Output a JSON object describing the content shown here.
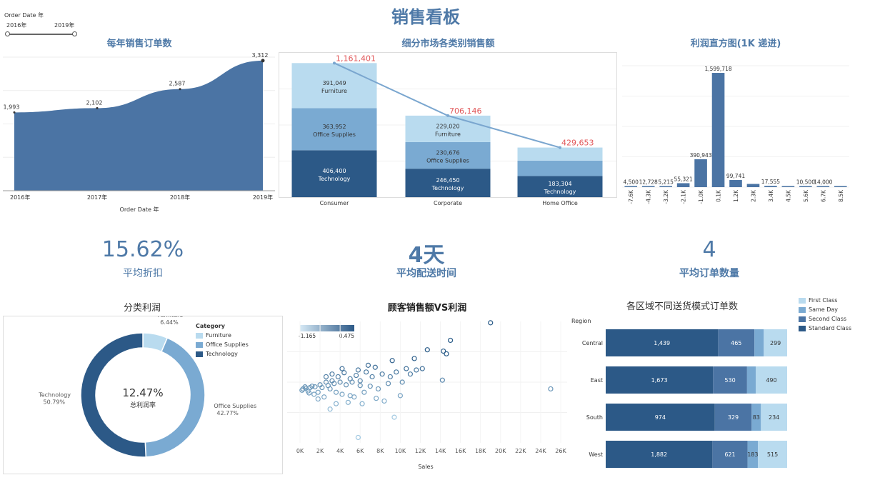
{
  "dashboard": {
    "title": "销售看板",
    "filter": {
      "field_label": "Order Date 年",
      "start_label": "2016年",
      "end_label": "2019年"
    }
  },
  "kpis": [
    {
      "value": "15.62%",
      "label": "平均折扣"
    },
    {
      "value": "4天",
      "label": "平均配送时间"
    },
    {
      "value": "4",
      "label": "平均订单数量"
    }
  ],
  "colors": {
    "brand": "#4e79a7",
    "furniture": "#b9dbef",
    "office_supplies": "#7aaad2",
    "technology": "#2c5987",
    "area_fill": "#4b74a4",
    "line_total": "#7aa6cf",
    "total_label": "#e15759"
  },
  "chart_data": [
    {
      "id": "orders_per_year",
      "type": "area",
      "title": "每年销售订单数",
      "xlabel": "Order Date 年",
      "x": [
        "2016年",
        "2017年",
        "2018年",
        "2019年"
      ],
      "values": [
        1993,
        2102,
        2587,
        3312
      ],
      "value_labels": [
        "1,993",
        "2,102",
        "2,587",
        "3,312"
      ],
      "ylim": [
        0,
        3400
      ]
    },
    {
      "id": "segment_sales",
      "type": "bar",
      "stacked": true,
      "title": "细分市场各类别销售额",
      "categories": [
        "Consumer",
        "Corporate",
        "Home Office"
      ],
      "series": [
        {
          "name": "Technology",
          "values": [
            406400,
            246450,
            183304
          ],
          "labels": [
            "406,400",
            "246,450",
            "183,304"
          ]
        },
        {
          "name": "Office Supplies",
          "values": [
            363952,
            230676,
            133000
          ],
          "labels": [
            "363,952",
            "230,676",
            ""
          ]
        },
        {
          "name": "Furniture",
          "values": [
            391049,
            229020,
            113349
          ],
          "labels": [
            "391,049",
            "229,020",
            ""
          ]
        }
      ],
      "totals": [
        1161401,
        706146,
        429653
      ],
      "total_labels": [
        "1,161,401",
        "706,146",
        "429,653"
      ],
      "ylim": [
        0,
        1250000
      ]
    },
    {
      "id": "profit_histogram",
      "type": "bar",
      "title": "利润直方图(1K 递进)",
      "categories": [
        "-7.6K",
        "-4.3K",
        "-3.2K",
        "-2.1K",
        "-1.0K",
        "0.1K",
        "1.2K",
        "2.3K",
        "3.4K",
        "4.5K",
        "5.6K",
        "6.7K",
        "8.5K"
      ],
      "values": [
        4500,
        12728,
        5215,
        55321,
        390943,
        1599718,
        99741,
        45000,
        17555,
        8000,
        10500,
        14000,
        5000
      ],
      "value_labels": [
        "4,500",
        "12,728",
        "5,215",
        "55,321",
        "390,943",
        "1,599,718",
        "99,741",
        "",
        "17,555",
        "",
        "10,500",
        "14,000",
        ""
      ],
      "ylim": [
        0,
        1700000
      ]
    },
    {
      "id": "category_profit",
      "type": "pie",
      "title": "分类利润",
      "center_value": "12.47%",
      "center_label": "总利润率",
      "legend_title": "Category",
      "labels": [
        "Furniture",
        "Office Supplies",
        "Technology"
      ],
      "values": [
        6.44,
        42.77,
        50.79
      ],
      "value_labels": [
        "6.44%",
        "42.77%",
        "50.79%"
      ]
    },
    {
      "id": "customer_sales_profit",
      "type": "scatter",
      "title": "顾客销售额VS利润",
      "xlabel": "Sales",
      "x_ticks": [
        "0K",
        "2K",
        "4K",
        "6K",
        "8K",
        "10K",
        "12K",
        "14K",
        "16K",
        "18K",
        "20K",
        "22K",
        "24K",
        "26K"
      ],
      "xlim": [
        0,
        26000
      ],
      "ylim": [
        -0.8,
        1.0
      ],
      "color_legend": {
        "min_label": "-1.165",
        "max_label": "0.475"
      },
      "points": [
        [
          19000,
          0.98
        ],
        [
          15000,
          0.72
        ],
        [
          14300,
          0.56
        ],
        [
          14600,
          0.52
        ],
        [
          12700,
          0.58
        ],
        [
          11400,
          0.45
        ],
        [
          9200,
          0.42
        ],
        [
          14200,
          0.13
        ],
        [
          25000,
          0.0
        ],
        [
          9400,
          -0.42
        ],
        [
          5800,
          -0.72
        ],
        [
          3000,
          -0.3
        ],
        [
          3600,
          -0.22
        ],
        [
          8800,
          0.08
        ],
        [
          11000,
          0.22
        ],
        [
          10200,
          0.1
        ],
        [
          7500,
          0.32
        ],
        [
          6600,
          0.25
        ],
        [
          5600,
          0.2
        ],
        [
          5000,
          0.15
        ],
        [
          4400,
          0.24
        ],
        [
          3800,
          0.18
        ],
        [
          3200,
          0.12
        ],
        [
          2600,
          0.1
        ],
        [
          2000,
          0.06
        ],
        [
          1500,
          0.03
        ],
        [
          1000,
          0.02
        ],
        [
          600,
          0.01
        ],
        [
          300,
          0.0
        ],
        [
          200,
          -0.02
        ],
        [
          800,
          -0.03
        ],
        [
          1200,
          0.04
        ],
        [
          1800,
          -0.05
        ],
        [
          2200,
          0.02
        ],
        [
          2800,
          0.05
        ],
        [
          3400,
          0.08
        ],
        [
          4000,
          0.1
        ],
        [
          4600,
          0.06
        ],
        [
          5200,
          0.1
        ],
        [
          6000,
          0.12
        ],
        [
          6400,
          -0.05
        ],
        [
          7000,
          0.04
        ],
        [
          7800,
          0.0
        ],
        [
          8400,
          -0.18
        ],
        [
          9000,
          0.18
        ],
        [
          10000,
          -0.1
        ],
        [
          10600,
          0.3
        ],
        [
          11600,
          0.28
        ],
        [
          12200,
          0.3
        ],
        [
          5400,
          -0.12
        ],
        [
          4800,
          -0.2
        ],
        [
          4200,
          -0.08
        ],
        [
          3600,
          -0.05
        ],
        [
          3000,
          0.0
        ],
        [
          2400,
          -0.12
        ],
        [
          1800,
          -0.15
        ],
        [
          1400,
          -0.08
        ],
        [
          900,
          -0.06
        ],
        [
          500,
          0.03
        ],
        [
          2600,
          0.18
        ],
        [
          3200,
          0.22
        ],
        [
          4200,
          0.3
        ],
        [
          5800,
          0.28
        ],
        [
          6800,
          0.35
        ],
        [
          7200,
          0.18
        ],
        [
          8200,
          0.22
        ],
        [
          9600,
          0.25
        ],
        [
          6200,
          -0.22
        ],
        [
          5000,
          -0.1
        ],
        [
          7600,
          -0.14
        ],
        [
          6000,
          0.05
        ]
      ]
    },
    {
      "id": "region_ship_mode",
      "type": "bar",
      "orientation": "horizontal",
      "stacked": true,
      "title": "各区域不同送货模式订单数",
      "ylabel": "Region",
      "categories": [
        "Central",
        "East",
        "South",
        "West"
      ],
      "series": [
        {
          "name": "Standard Class",
          "values": [
            1439,
            1673,
            974,
            1882
          ],
          "labels": [
            "1,439",
            "1,673",
            "974",
            "1,882"
          ]
        },
        {
          "name": "Second Class",
          "values": [
            465,
            530,
            329,
            621
          ],
          "labels": [
            "465",
            "530",
            "329",
            "621"
          ]
        },
        {
          "name": "Same Day",
          "values": [
            120,
            135,
            83,
            183
          ],
          "labels": [
            "",
            "",
            "83",
            "183"
          ]
        },
        {
          "name": "First Class",
          "values": [
            299,
            490,
            234,
            515
          ],
          "labels": [
            "299",
            "490",
            "234",
            "515"
          ]
        }
      ],
      "legend": [
        "First Class",
        "Same Day",
        "Second Class",
        "Standard Class"
      ]
    }
  ]
}
